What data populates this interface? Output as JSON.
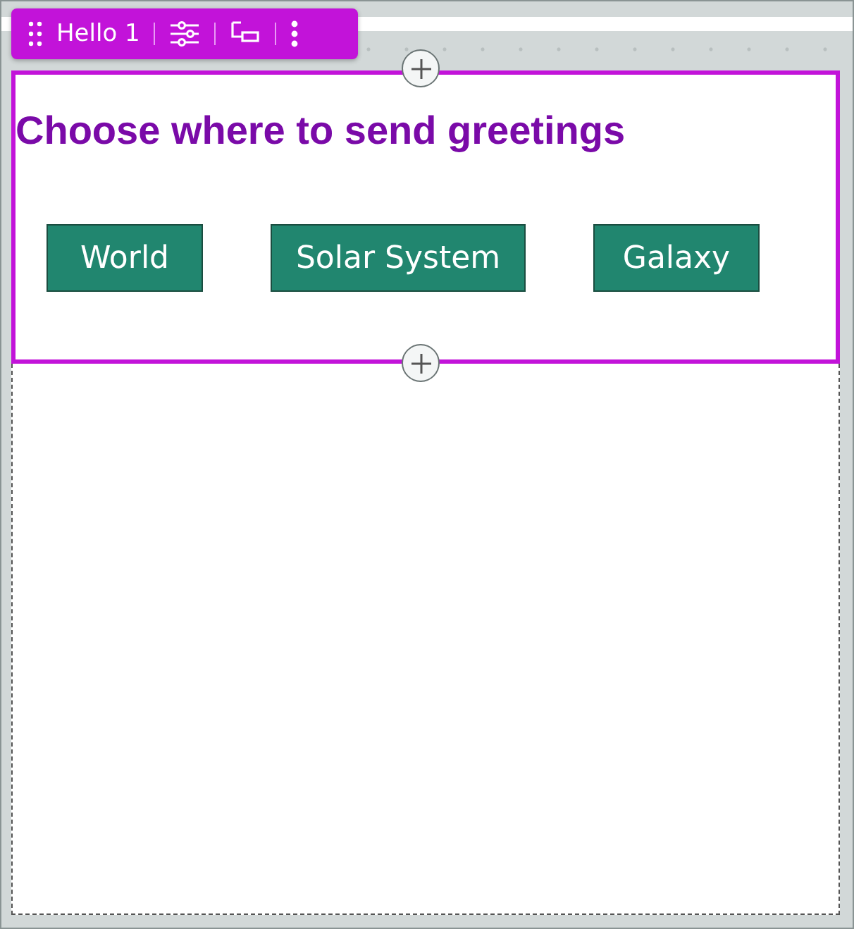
{
  "toolbar": {
    "label": "Hello 1"
  },
  "block": {
    "heading": "Choose where to send greetings",
    "selected": true,
    "buttons": [
      {
        "label": "World"
      },
      {
        "label": "Solar System"
      },
      {
        "label": "Galaxy"
      }
    ]
  }
}
